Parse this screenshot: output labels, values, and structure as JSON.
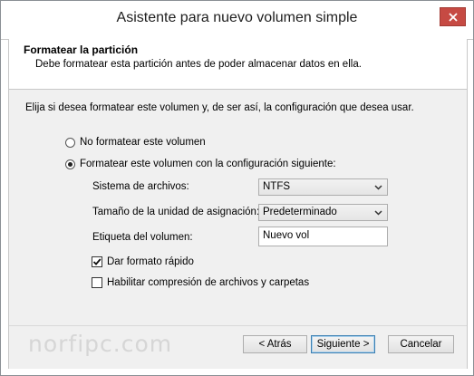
{
  "window": {
    "title": "Asistente para nuevo volumen simple"
  },
  "header": {
    "title": "Formatear la partición",
    "description": "Debe formatear esta partición antes de poder almacenar datos en ella."
  },
  "main": {
    "intro": "Elija si desea formatear este volumen y, de ser así, la configuración que desea usar.",
    "options": [
      {
        "label": "No formatear este volumen",
        "selected": false
      },
      {
        "label": "Formatear este volumen con la configuración siguiente:",
        "selected": true
      }
    ],
    "fields": {
      "file_system": {
        "label": "Sistema de archivos:",
        "value": "NTFS"
      },
      "allocation_unit": {
        "label": "Tamaño de la unidad de asignación:",
        "value": "Predeterminado"
      },
      "volume_label": {
        "label": "Etiqueta del volumen:",
        "value": "Nuevo vol"
      }
    },
    "checkboxes": [
      {
        "label": "Dar formato rápido",
        "checked": true
      },
      {
        "label": "Habilitar compresión de archivos y carpetas",
        "checked": false
      }
    ]
  },
  "footer": {
    "watermark": "norfipc.com",
    "back_label": "< Atrás",
    "next_label": "Siguiente >",
    "cancel_label": "Cancelar"
  },
  "colors": {
    "close_button": "#c64a43",
    "default_button_border": "#3c7fb1"
  },
  "icons": {
    "close": "close-icon",
    "dropdown": "chevron-down-icon",
    "check": "checkmark-icon"
  }
}
